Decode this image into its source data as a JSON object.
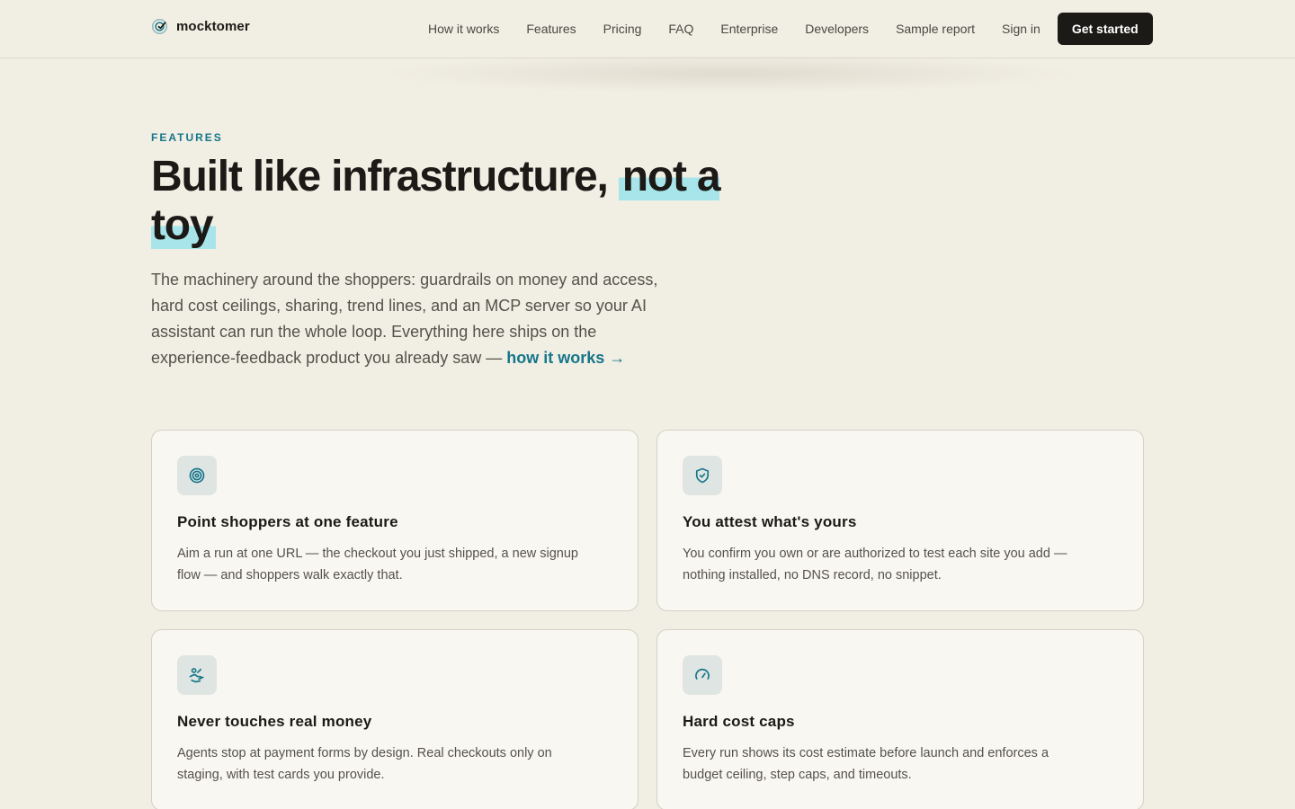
{
  "brand": {
    "name": "mocktomer",
    "icon": "target-check-icon"
  },
  "nav": {
    "items": [
      "How it works",
      "Features",
      "Pricing",
      "FAQ",
      "Enterprise",
      "Developers",
      "Sample report",
      "Sign in"
    ],
    "cta": "Get started"
  },
  "hero": {
    "eyebrow": "FEATURES",
    "title_plain": "Built like infrastructure, ",
    "title_highlight": "not a toy",
    "lead": "The machinery around the shoppers: guardrails on money and access, hard cost ceilings, sharing, trend lines, and an MCP server so your AI assistant can run the whole loop. Everything here ships on the experience-feedback product you already saw — ",
    "lead_link": "how it works →"
  },
  "features": [
    {
      "icon": "target-icon",
      "title": "Point shoppers at one feature",
      "body": "Aim a run at one URL — the checkout you just shipped, a new signup flow — and shoppers walk exactly that."
    },
    {
      "icon": "shield-check-icon",
      "title": "You attest what's yours",
      "body": "You confirm you own or are authorized to test each site you add — nothing installed, no DNS record, no snippet."
    },
    {
      "icon": "hand-coins-icon",
      "title": "Never touches real money",
      "body": "Agents stop at payment forms by design. Real checkouts only on staging, with test cards you provide."
    },
    {
      "icon": "gauge-icon",
      "title": "Hard cost caps",
      "body": "Every run shows its cost estimate before launch and enforces a budget ceiling, step caps, and timeouts."
    }
  ],
  "colors": {
    "accent": "#16768a",
    "highlight": "#a8e5ea",
    "background": "#f1eee4",
    "cta": "#1c1a17"
  }
}
